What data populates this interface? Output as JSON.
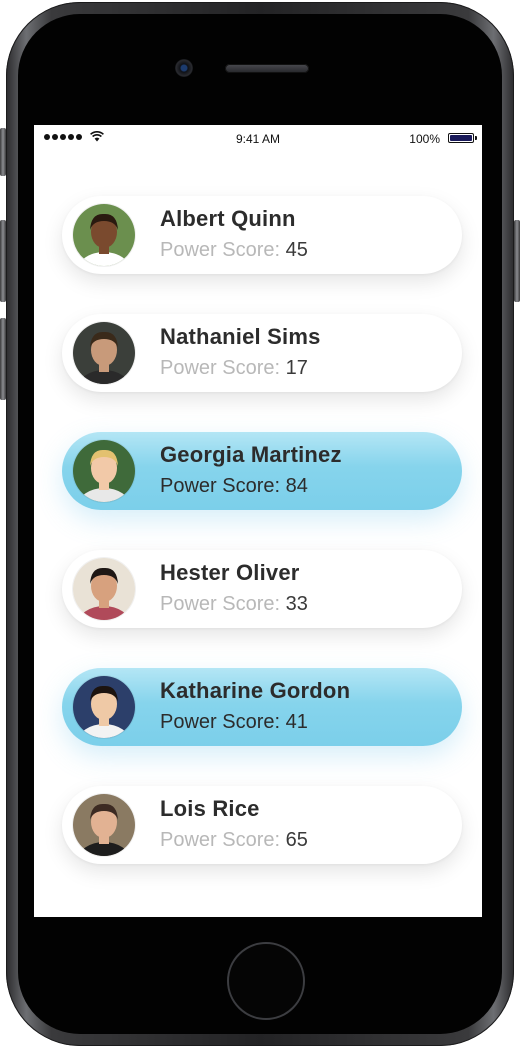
{
  "status_bar": {
    "time": "9:41 AM",
    "battery": "100%"
  },
  "score_label": "Power Score:",
  "colors": {
    "highlight": "#86d4ec",
    "name_text": "#2c2c2c",
    "label_muted": "#b8b8b8"
  },
  "people": [
    {
      "name": "Albert Quinn",
      "score": "45",
      "highlighted": false,
      "avatar": "avatar-photo"
    },
    {
      "name": "Nathaniel Sims",
      "score": "17",
      "highlighted": false,
      "avatar": "avatar-photo"
    },
    {
      "name": "Georgia Martinez",
      "score": "84",
      "highlighted": true,
      "avatar": "avatar-photo"
    },
    {
      "name": "Hester Oliver",
      "score": "33",
      "highlighted": false,
      "avatar": "avatar-photo"
    },
    {
      "name": "Katharine Gordon",
      "score": "41",
      "highlighted": true,
      "avatar": "avatar-photo"
    },
    {
      "name": "Lois Rice",
      "score": "65",
      "highlighted": false,
      "avatar": "avatar-photo"
    }
  ]
}
